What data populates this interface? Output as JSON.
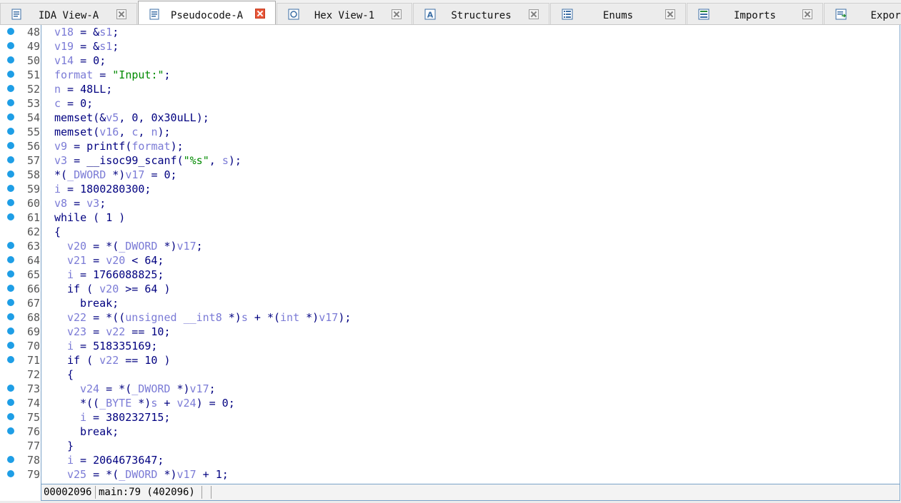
{
  "tabs": [
    {
      "label": "IDA View-A",
      "active": false,
      "icon": "ida-view-icon"
    },
    {
      "label": "Pseudocode-A",
      "active": true,
      "icon": "pseudocode-icon"
    },
    {
      "label": "Hex View-1",
      "active": false,
      "icon": "hex-view-icon"
    },
    {
      "label": "Structures",
      "active": false,
      "icon": "structures-icon"
    },
    {
      "label": "Enums",
      "active": false,
      "icon": "enums-icon"
    },
    {
      "label": "Imports",
      "active": false,
      "icon": "imports-icon"
    },
    {
      "label": "Exports",
      "active": false,
      "icon": "exports-icon"
    }
  ],
  "code_lines": [
    {
      "num": "48",
      "dot": true,
      "indent": 0,
      "text": "v18 = &s1;"
    },
    {
      "num": "49",
      "dot": true,
      "indent": 0,
      "text": "v19 = &s1;"
    },
    {
      "num": "50",
      "dot": true,
      "indent": 0,
      "text": "v14 = 0;"
    },
    {
      "num": "51",
      "dot": true,
      "indent": 0,
      "text": "format = \"Input:\";"
    },
    {
      "num": "52",
      "dot": true,
      "indent": 0,
      "text": "n = 48LL;"
    },
    {
      "num": "53",
      "dot": true,
      "indent": 0,
      "text": "c = 0;"
    },
    {
      "num": "54",
      "dot": true,
      "indent": 0,
      "text": "memset(&v5, 0, 0x30uLL);"
    },
    {
      "num": "55",
      "dot": true,
      "indent": 0,
      "text": "memset(v16, c, n);"
    },
    {
      "num": "56",
      "dot": true,
      "indent": 0,
      "text": "v9 = printf(format);"
    },
    {
      "num": "57",
      "dot": true,
      "indent": 0,
      "text": "v3 = __isoc99_scanf(\"%s\", s);"
    },
    {
      "num": "58",
      "dot": true,
      "indent": 0,
      "text": "*(_DWORD *)v17 = 0;"
    },
    {
      "num": "59",
      "dot": true,
      "indent": 0,
      "text": "i = 1800280300;"
    },
    {
      "num": "60",
      "dot": true,
      "indent": 0,
      "text": "v8 = v3;"
    },
    {
      "num": "61",
      "dot": true,
      "indent": 0,
      "text": "while ( 1 )"
    },
    {
      "num": "62",
      "dot": false,
      "indent": 0,
      "text": "{"
    },
    {
      "num": "63",
      "dot": true,
      "indent": 1,
      "text": "v20 = *(_DWORD *)v17;"
    },
    {
      "num": "64",
      "dot": true,
      "indent": 1,
      "text": "v21 = v20 < 64;"
    },
    {
      "num": "65",
      "dot": true,
      "indent": 1,
      "text": "i = 1766088825;"
    },
    {
      "num": "66",
      "dot": true,
      "indent": 1,
      "text": "if ( v20 >= 64 )"
    },
    {
      "num": "67",
      "dot": true,
      "indent": 2,
      "text": "break;"
    },
    {
      "num": "68",
      "dot": true,
      "indent": 1,
      "text": "v22 = *((unsigned __int8 *)s + *(int *)v17);"
    },
    {
      "num": "69",
      "dot": true,
      "indent": 1,
      "text": "v23 = v22 == 10;"
    },
    {
      "num": "70",
      "dot": true,
      "indent": 1,
      "text": "i = 518335169;"
    },
    {
      "num": "71",
      "dot": true,
      "indent": 1,
      "text": "if ( v22 == 10 )"
    },
    {
      "num": "72",
      "dot": false,
      "indent": 1,
      "text": "{"
    },
    {
      "num": "73",
      "dot": true,
      "indent": 2,
      "text": "v24 = *(_DWORD *)v17;"
    },
    {
      "num": "74",
      "dot": true,
      "indent": 2,
      "text": "*((_BYTE *)s + v24) = 0;"
    },
    {
      "num": "75",
      "dot": true,
      "indent": 2,
      "text": "i = 380232715;"
    },
    {
      "num": "76",
      "dot": true,
      "indent": 2,
      "text": "break;"
    },
    {
      "num": "77",
      "dot": false,
      "indent": 1,
      "text": "}"
    },
    {
      "num": "78",
      "dot": true,
      "indent": 1,
      "text": "i = 2064673647;"
    },
    {
      "num": "79",
      "dot": true,
      "indent": 1,
      "text": "v25 = *(_DWORD *)v17 + 1;"
    }
  ],
  "status": {
    "address": "00002096",
    "location": "main:79 (402096)"
  },
  "colors": {
    "keyword": "#000080",
    "variable": "#7b7bd6",
    "string": "#008a00",
    "breakpoint_dot": "#1e9ee6",
    "active_close": "#e8573a"
  }
}
